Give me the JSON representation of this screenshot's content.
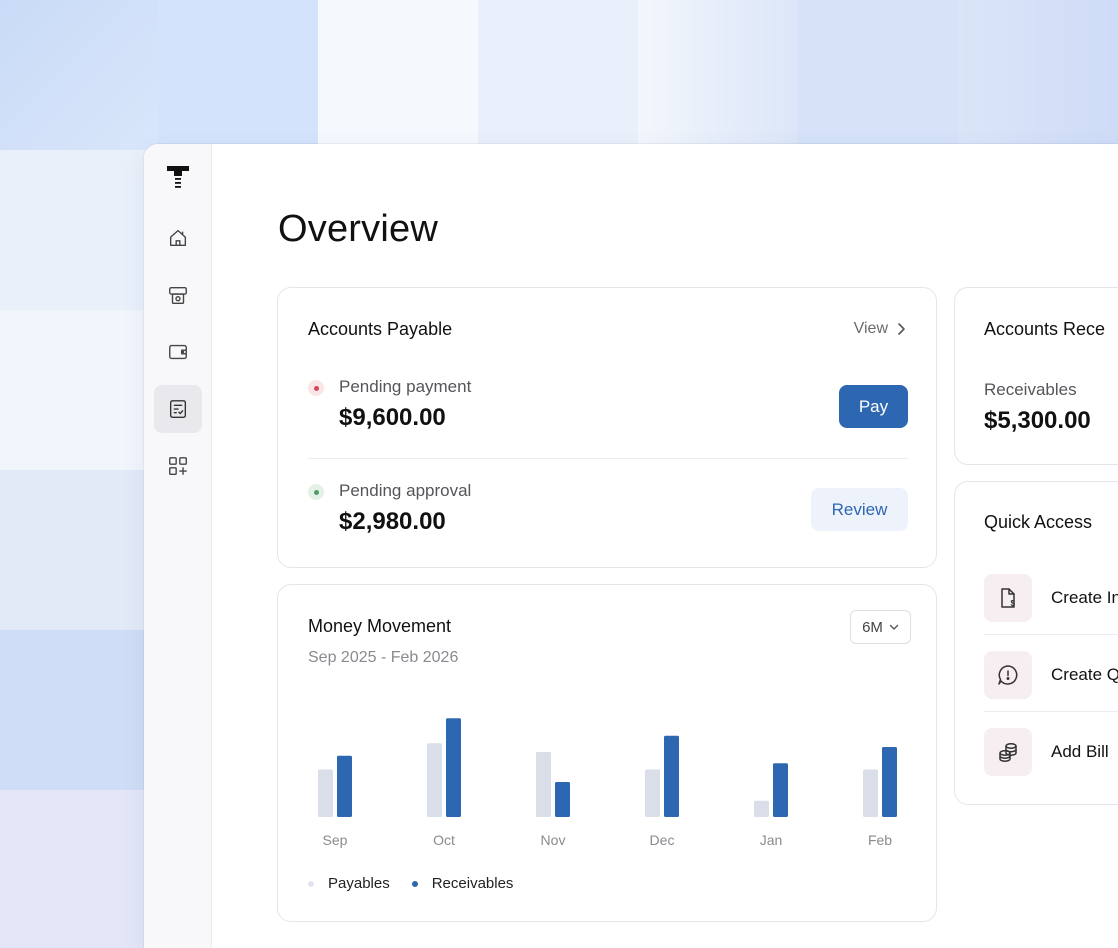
{
  "page": {
    "title": "Overview"
  },
  "sidebar": {
    "items": [
      {
        "icon": "home-icon"
      },
      {
        "icon": "vault-icon"
      },
      {
        "icon": "wallet-icon"
      },
      {
        "icon": "bills-icon",
        "active": true
      },
      {
        "icon": "apps-add-icon"
      }
    ]
  },
  "payables": {
    "title": "Accounts Payable",
    "view_label": "View",
    "rows": [
      {
        "label": "Pending payment",
        "amount": "$9,600.00",
        "action": "Pay",
        "status_color": "#d44a5a"
      },
      {
        "label": "Pending approval",
        "amount": "$2,980.00",
        "action": "Review",
        "status_color": "#4e9b66"
      }
    ]
  },
  "money": {
    "title": "Money Movement",
    "date_range": "Sep 2025 - Feb 2026",
    "range_select": "6M"
  },
  "chart_data": {
    "type": "bar",
    "categories": [
      "Sep",
      "Oct",
      "Nov",
      "Dec",
      "Jan",
      "Feb"
    ],
    "series": [
      {
        "name": "Payables",
        "color": "#d9dee8",
        "values": [
          38,
          59,
          52,
          38,
          13,
          38
        ]
      },
      {
        "name": "Receivables",
        "color": "#2e67b1",
        "values": [
          49,
          79,
          28,
          65,
          43,
          56
        ]
      }
    ],
    "ylim": [
      0,
      80
    ],
    "grid": false,
    "legend": "bottom-left"
  },
  "receivables": {
    "title": "Accounts Rece",
    "label": "Receivables",
    "amount": "$5,300.00"
  },
  "quick_access": {
    "title": "Quick Access",
    "items": [
      {
        "label": "Create In",
        "icon": "invoice-dollar-icon"
      },
      {
        "label": "Create Q",
        "icon": "quote-bubble-icon"
      },
      {
        "label": "Add Bill",
        "icon": "coins-icon"
      }
    ]
  },
  "colors": {
    "accent": "#2e67b1",
    "review_bg": "#eef3fb",
    "quick_icon_bg": "#f6eef0"
  }
}
